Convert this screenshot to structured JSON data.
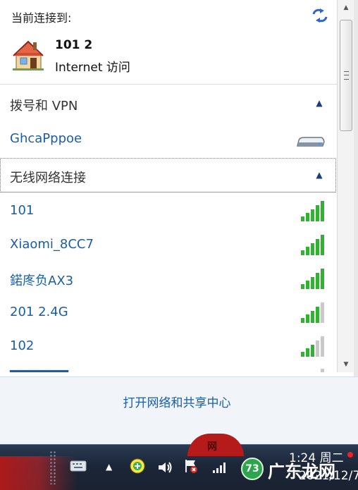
{
  "header": {
    "connected_title": "当前连接到:",
    "network_name": "101  2",
    "network_access": "Internet 访问"
  },
  "dialup_section": {
    "title": "拨号和 VPN",
    "item": "GhcaPppoe"
  },
  "wireless_section": {
    "title": "无线网络连接",
    "networks": [
      {
        "name": "101",
        "signal_bars": 5
      },
      {
        "name": "Xiaomi_8CC7",
        "signal_bars": 5
      },
      {
        "name": "鍩庝负AX3",
        "signal_bars": 5
      },
      {
        "name": "201 2.4G",
        "signal_bars": 4
      },
      {
        "name": "102",
        "signal_bars": 3
      }
    ]
  },
  "footer": {
    "link": "打开网络和共享中心"
  },
  "taskbar": {
    "time": "1:24 周二",
    "date": "2021/12/7",
    "badge_number": "73",
    "watermark": "广东龙网",
    "red_overlay_text": "网"
  },
  "icons": {
    "refresh": "refresh-icon",
    "house": "house-network-icon",
    "modem": "modem-icon",
    "signal": "signal-bars-icon",
    "keyboard": "keyboard-icon",
    "volume": "speaker-icon",
    "flag": "action-center-flag-icon",
    "network": "network-tray-icon",
    "green_plus": "green-plus-icon"
  },
  "colors": {
    "link": "#1a5ea8",
    "signal_active": "#2db52d",
    "signal_inactive": "#c9c9c9",
    "taskbar": "#1b2638"
  }
}
